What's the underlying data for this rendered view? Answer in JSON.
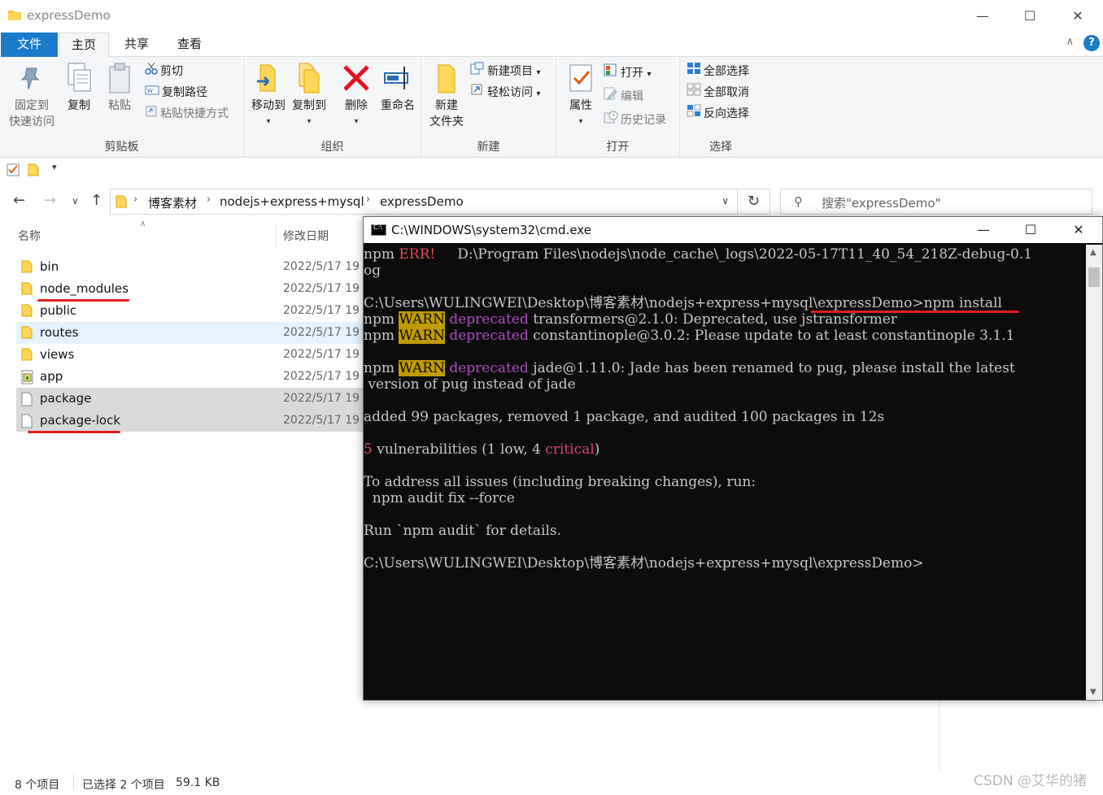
{
  "window": {
    "title": "expressDemo",
    "minimize": "—",
    "maximize": "☐",
    "close": "✕"
  },
  "ribbon_tabs": [
    "文件",
    "主页",
    "共享",
    "查看"
  ],
  "help": "?",
  "ribbon": {
    "clipboard": {
      "label": "剪贴板",
      "pin_line1": "固定到",
      "pin_line2": "快速访问",
      "copy": "复制",
      "paste": "粘贴",
      "cut": "剪切",
      "copy_path": "复制路径",
      "paste_shortcut": "粘贴快捷方式"
    },
    "organize": {
      "label": "组织",
      "move_to": "移动到",
      "copy_to": "复制到",
      "delete": "删除",
      "rename": "重命名"
    },
    "new": {
      "label": "新建",
      "new_folder_line1": "新建",
      "new_folder_line2": "文件夹",
      "new_item": "新建项目",
      "easy_access": "轻松访问"
    },
    "open": {
      "label": "打开",
      "properties": "属性",
      "open": "打开",
      "edit": "编辑",
      "history": "历史记录"
    },
    "select": {
      "label": "选择",
      "select_all": "全部选择",
      "select_none": "全部取消",
      "invert": "反向选择"
    }
  },
  "address": {
    "crumbs": [
      "博客素材",
      "nodejs+express+mysql",
      "expressDemo"
    ],
    "search_placeholder": "搜索\"expressDemo\""
  },
  "columns": {
    "name": "名称",
    "modified": "修改日期"
  },
  "files": [
    {
      "name": "bin",
      "date": "2022/5/17 19",
      "type": "folder"
    },
    {
      "name": "node_modules",
      "date": "2022/5/17 19",
      "type": "folder"
    },
    {
      "name": "public",
      "date": "2022/5/17 19",
      "type": "folder"
    },
    {
      "name": "routes",
      "date": "2022/5/17 19",
      "type": "folder"
    },
    {
      "name": "views",
      "date": "2022/5/17 19",
      "type": "folder"
    },
    {
      "name": "app",
      "date": "2022/5/17 19",
      "type": "js"
    },
    {
      "name": "package",
      "date": "2022/5/17 19",
      "type": "file"
    },
    {
      "name": "package-lock",
      "date": "2022/5/17 19",
      "type": "file"
    }
  ],
  "status": {
    "count": "8 个项目",
    "selected": "已选择 2 个项目",
    "size": "59.1 KB"
  },
  "watermark": "CSDN @艾华的猪",
  "cmd": {
    "title": "C:\\WINDOWS\\system32\\cmd.exe",
    "l1_prefix": "npm ",
    "l1_err": "ERR!",
    "l1_rest": "     D:\\Program Files\\nodejs\\node_cache\\_logs\\2022-05-17T11_40_54_218Z-debug-0.1",
    "l2": "og",
    "l3": "C:\\Users\\WULINGWEI\\Desktop\\博客素材\\nodejs+express+mysql\\expressDemo>npm install",
    "npm": "npm ",
    "warn": "WARN",
    "deprecated": "deprecated",
    "l4_rest": " transformers@2.1.0: Deprecated, use jstransformer",
    "l5_rest": " constantinople@3.0.2: Please update to at least constantinople 3.1.1",
    "l6_rest": " jade@1.11.0: Jade has been renamed to pug, please install the latest",
    "l7": " version of pug instead of jade",
    "l8": "added 99 packages, removed 1 package, and audited 100 packages in 12s",
    "l9_num": "5",
    "l9_mid": " vulnerabilities (1 low, 4 ",
    "l9_crit": "critical",
    "l9_end": ")",
    "l10": "To address all issues (including breaking changes), run:",
    "l11": "  npm audit fix --force",
    "l12": "Run `npm audit` for details.",
    "l13": "C:\\Users\\WULINGWEI\\Desktop\\博客素材\\nodejs+express+mysql\\expressDemo>"
  }
}
